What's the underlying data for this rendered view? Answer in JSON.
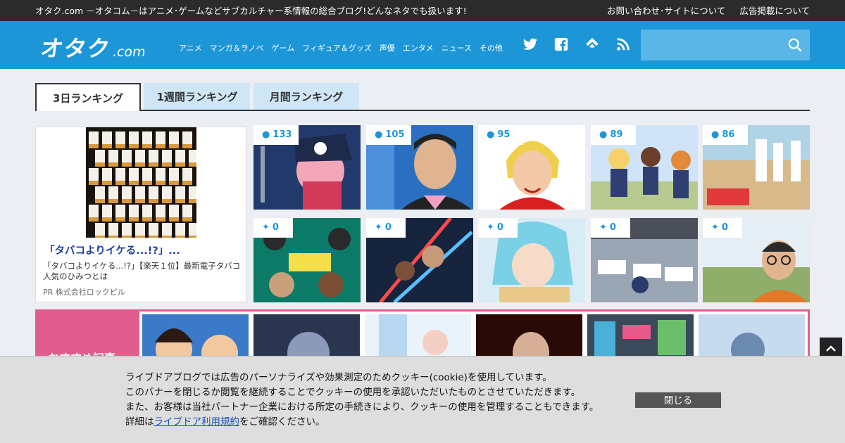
{
  "topbar": {
    "tagline": "オタク.com －オタコム－はアニメ･ゲームなどサブカルチャー系情報の総合ブログ!どんなネタでも扱います!",
    "links": [
      "お問い合わせ･サイトについて",
      "広告掲載について"
    ]
  },
  "header": {
    "logo_main": "オタク",
    "logo_sub": ".com",
    "nav": [
      "アニメ",
      "マンガ＆ラノベ",
      "ゲーム",
      "フィギュア＆グッズ",
      "声優",
      "エンタメ",
      "ニュース",
      "その他"
    ],
    "social_icons": [
      "twitter-icon",
      "facebook-icon",
      "feedly-icon",
      "rss-icon"
    ],
    "search": {
      "placeholder": ""
    }
  },
  "tabs": [
    "3日ランキング",
    "1週間ランキング",
    "月間ランキング"
  ],
  "ad": {
    "title": "「タバコよりイケる...!?」...",
    "description": "「タバコよりイケる...!?」【楽天１位】最新電子タバコ人気のひみつとは",
    "sponsor": "PR  株式会社ロックビル"
  },
  "ranking_row1": [
    {
      "count": "133"
    },
    {
      "count": "105"
    },
    {
      "count": "95"
    },
    {
      "count": "89"
    },
    {
      "count": "86"
    }
  ],
  "ranking_row2": [
    {
      "count": "0"
    },
    {
      "count": "0"
    },
    {
      "count": "0"
    },
    {
      "count": "0"
    },
    {
      "count": "0"
    }
  ],
  "strip": {
    "label": "おすすめ記事"
  },
  "cookie": {
    "line1": "ライブドアブログでは広告のパーソナライズや効果測定のためクッキー(cookie)を使用しています。",
    "line2": "このバナーを閉じるか閲覧を継続することでクッキーの使用を承認いただいたものとさせていただきます。",
    "line3": "また、お客様は当社パートナー企業における所定の手続きにより、クッキーの使用を管理することもできます。",
    "line4_pre": "詳細は",
    "line4_link": "ライブドア利用規約",
    "line4_post": "をご確認ください。",
    "close_label": "閉じる"
  },
  "colors": {
    "header_blue": "#1d96d8",
    "strip_pink": "#e15d8d",
    "tab_inactive": "#cfe6f6"
  }
}
